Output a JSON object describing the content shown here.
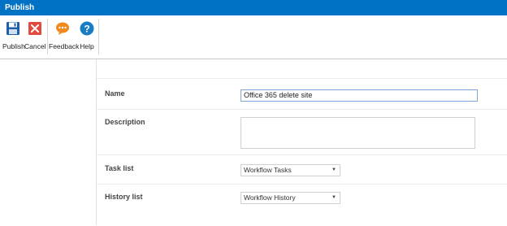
{
  "window": {
    "title": "Publish"
  },
  "toolbar": {
    "publish_label": "Publish",
    "cancel_label": "Cancel",
    "feedback_label": "Feedback",
    "help_label": "Help"
  },
  "form": {
    "name_label": "Name",
    "name_value": "Office 365 delete site",
    "description_label": "Description",
    "description_value": "",
    "task_list_label": "Task list",
    "task_list_value": "Workflow Tasks",
    "history_list_label": "History list",
    "history_list_value": "Workflow History"
  },
  "colors": {
    "titlebar": "#0072c6",
    "publish_icon": "#1f5fa8",
    "cancel_icon": "#e04b3c",
    "feedback_icon": "#f08a1d",
    "help_icon": "#1a7dc4"
  }
}
